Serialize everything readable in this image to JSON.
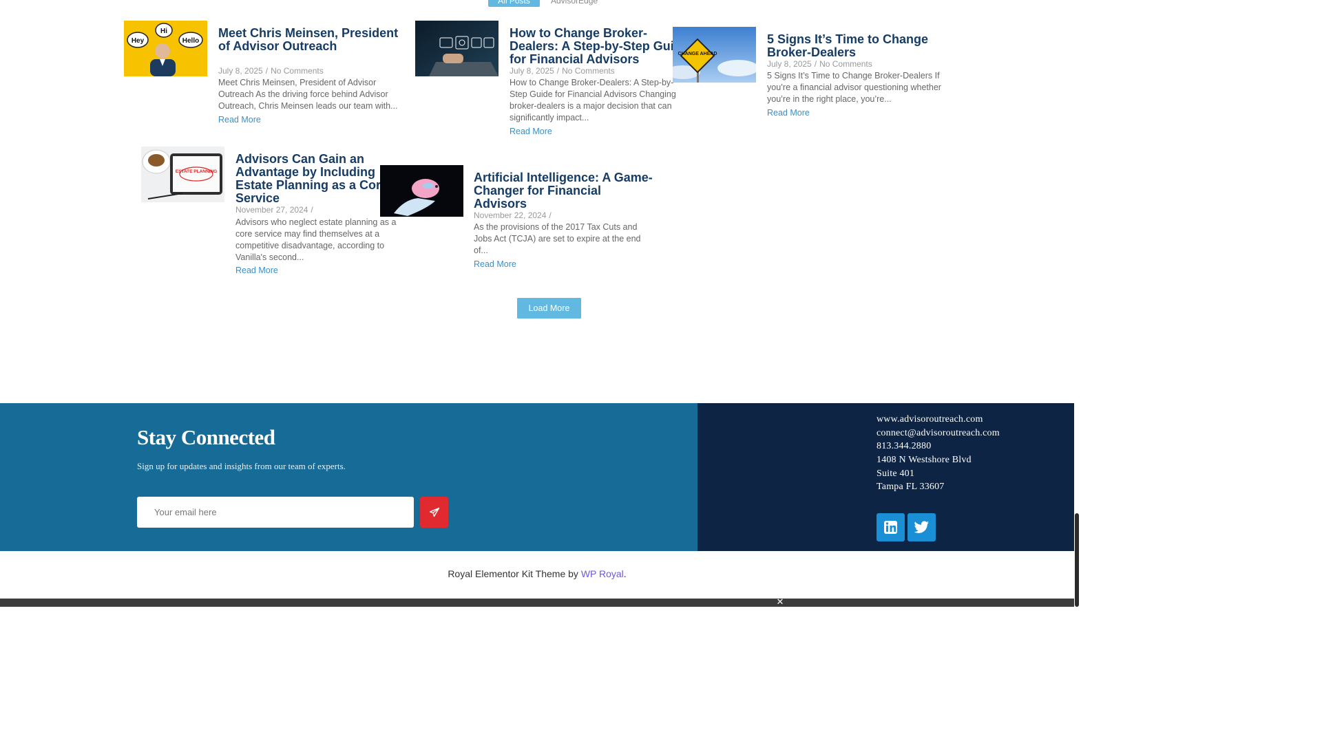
{
  "filters": {
    "active": "All Posts",
    "other": "AdvisorEdge"
  },
  "posts": [
    {
      "title": "Meet Chris Meinsen, President of Advisor Outreach",
      "date": "July 8, 2025",
      "comments": "No Comments",
      "excerpt": "Meet Chris Meinsen, President of Advisor Outreach As the driving force behind Advisor Outreach, Chris Meinsen leads our team with...",
      "read_more": "Read More",
      "bubbles": [
        "Hey",
        "Hi",
        "Hello"
      ]
    },
    {
      "title": "How to Change Broker-Dealers: A Step-by-Step Guide for Financial Advisors",
      "date": "July 8, 2025",
      "comments": "No Comments",
      "excerpt": "How to Change Broker-Dealers: A Step-by-Step Guide for Financial Advisors Changing broker-dealers is a major decision that can significantly impact...",
      "read_more": "Read More"
    },
    {
      "title": "5 Signs It’s Time to Change Broker-Dealers",
      "date": "July 8, 2025",
      "comments": "No Comments",
      "excerpt": "5 Signs It’s Time to Change Broker-Dealers If you’re a financial advisor questioning whether you’re in the right place, you’re...",
      "read_more": "Read More",
      "sign_text": "CHANGE AHEAD"
    },
    {
      "title": "Advisors Can Gain an Advantage by Including Estate Planning as a Core Service",
      "date": "November 27, 2024",
      "comments": "",
      "excerpt": "Advisors who neglect estate planning as a core service may find themselves at a competitive disadvantage, according to Vanilla's second...",
      "read_more": "Read More",
      "tablet_text": "ESTATE PLANNING"
    },
    {
      "title": "Artificial Intelligence: A Game-Changer for Financial Advisors",
      "date": "November 22, 2024",
      "comments": "",
      "excerpt": "As the provisions of the 2017 Tax Cuts and Jobs Act (TCJA) are set to expire at the end of...",
      "read_more": "Read More"
    }
  ],
  "load_more": "Load More",
  "newsletter": {
    "title": "Stay Connected",
    "subtitle": "Sign up for updates and insights from our team of experts.",
    "placeholder": "Your email here"
  },
  "contact": {
    "website": "www.advisoroutreach.com",
    "email": "connect@advisoroutreach.com",
    "phone": "813.344.2880",
    "address1": "1408 N Westshore Blvd",
    "address2": "Suite 401",
    "address3": "Tampa FL 33607"
  },
  "social": [
    {
      "icon": "linkedin-icon"
    },
    {
      "icon": "twitter-icon"
    }
  ],
  "colors": {
    "band_blue": "#176b97",
    "band_navy": "#0d2444",
    "accent": "#61b8e0",
    "title": "#163c65",
    "send": "#e02a2f"
  },
  "credits": {
    "prefix": "Royal Elementor Kit Theme by",
    "link": "WP Royal",
    "suffix": "."
  }
}
